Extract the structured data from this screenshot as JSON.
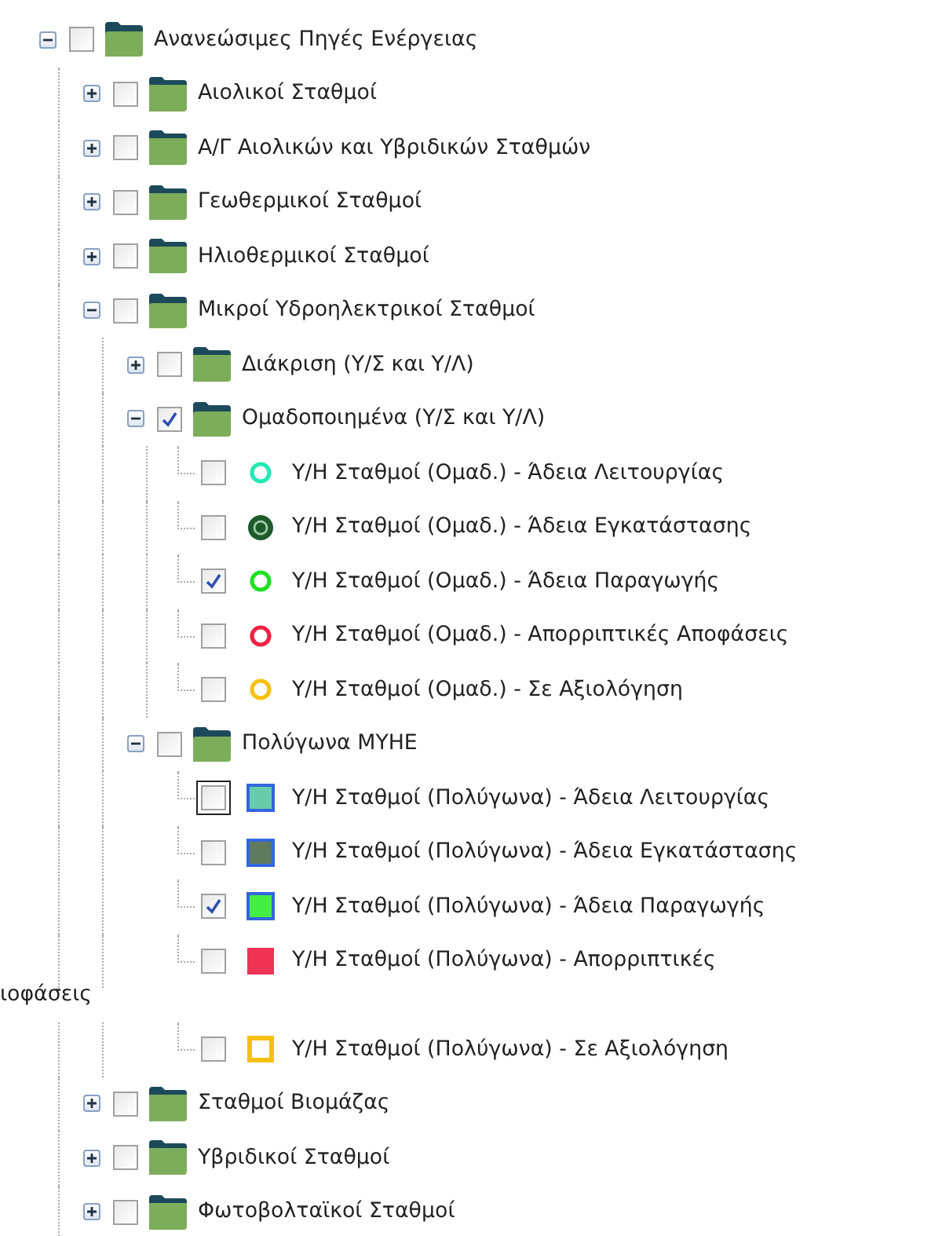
{
  "tree": [
    {
      "kind": "folder",
      "label": "Ανανεώσιμες Πηγές Ενέργειας",
      "expanded": true,
      "checked": false,
      "children": [
        {
          "kind": "folder",
          "label": "Αιολικοί Σταθμοί",
          "expanded": false,
          "checked": false
        },
        {
          "kind": "folder",
          "label": "Α/Γ Αιολικών και Υβριδικών Σταθμών",
          "expanded": false,
          "checked": false
        },
        {
          "kind": "folder",
          "label": "Γεωθερμικοί Σταθμοί",
          "expanded": false,
          "checked": false
        },
        {
          "kind": "folder",
          "label": "Ηλιοθερμικοί Σταθμοί",
          "expanded": false,
          "checked": false
        },
        {
          "kind": "folder",
          "label": "Μικροί Υδροηλεκτρικοί Σταθμοί",
          "expanded": true,
          "checked": false,
          "children": [
            {
              "kind": "folder",
              "label": "Διάκριση (Υ/Σ και Υ/Λ)",
              "expanded": false,
              "checked": false
            },
            {
              "kind": "folder",
              "label": "Ομαδοποιημένα (Υ/Σ και Υ/Λ)",
              "expanded": true,
              "checked": true,
              "children": [
                {
                  "kind": "ring",
                  "color": "#22e8b0",
                  "label": "Υ/Η Σταθμοί (Ομαδ.) - Άδεια Λειτουργίας",
                  "checked": false,
                  "focused": false
                },
                {
                  "kind": "target",
                  "color": "#1e5a2c",
                  "label": "Υ/Η Σταθμοί (Ομαδ.) - Άδεια Εγκατάστασης",
                  "checked": false,
                  "focused": false
                },
                {
                  "kind": "ring",
                  "color": "#22e022",
                  "label": "Υ/Η Σταθμοί (Ομαδ.) - Άδεια Παραγωγής",
                  "checked": true,
                  "focused": false
                },
                {
                  "kind": "ring",
                  "color": "#ee2244",
                  "label": "Υ/Η Σταθμοί (Ομαδ.) - Απορριπτικές Αποφάσεις",
                  "checked": false,
                  "focused": false
                },
                {
                  "kind": "ring",
                  "color": "#f5c010",
                  "label": "Υ/Η Σταθμοί (Ομαδ.) - Σε Αξιολόγηση",
                  "checked": false,
                  "focused": false
                }
              ]
            },
            {
              "kind": "folder",
              "label": "Πολύγωνα ΜΥΗΕ",
              "expanded": true,
              "checked": false,
              "children": [
                {
                  "kind": "square",
                  "color": "#66ccaa",
                  "label": "Υ/Η Σταθμοί (Πολύγωνα) - Άδεια Λειτουργίας",
                  "checked": false,
                  "focused": true
                },
                {
                  "kind": "square",
                  "color": "#5f7a5f",
                  "label": "Υ/Η Σταθμοί (Πολύγωνα) - Άδεια Εγκατάστασης",
                  "checked": false,
                  "focused": false
                },
                {
                  "kind": "square",
                  "color": "#44ee44",
                  "label": "Υ/Η Σταθμοί (Πολύγωνα) - Άδεια Παραγωγής",
                  "checked": true,
                  "focused": false
                },
                {
                  "kind": "block",
                  "color": "#ee3355",
                  "label": "Υ/Η Σταθμοί (Πολύγωνα) - Απορριπτικές",
                  "overflow": "ιοφάσεις",
                  "checked": false,
                  "focused": false
                },
                {
                  "kind": "frame",
                  "color": "#f5c010",
                  "label": "Υ/Η Σταθμοί (Πολύγωνα) - Σε Αξιολόγηση",
                  "checked": false,
                  "focused": false
                }
              ]
            }
          ]
        },
        {
          "kind": "folder",
          "label": "Σταθμοί Βιομάζας",
          "expanded": false,
          "checked": false
        },
        {
          "kind": "folder",
          "label": "Υβριδικοί Σταθμοί",
          "expanded": false,
          "checked": false
        },
        {
          "kind": "folder",
          "label": "Φωτοβολταϊκοί Σταθμοί",
          "expanded": false,
          "checked": false
        }
      ]
    }
  ]
}
